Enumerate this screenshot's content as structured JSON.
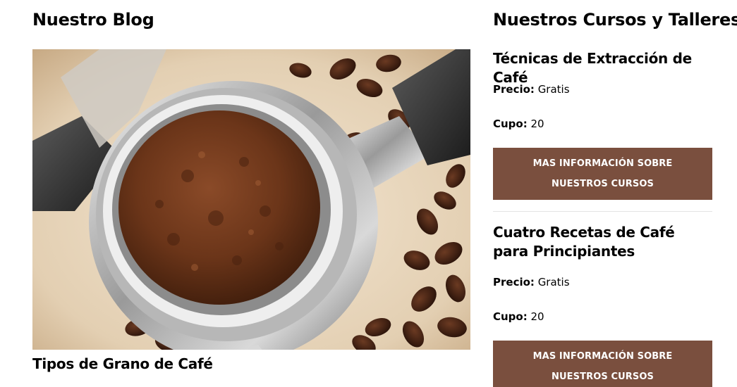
{
  "blog": {
    "heading": "Nuestro Blog",
    "post_title": "Tipos de Grano de Café",
    "image_icon": "coffee-portafilter-photo"
  },
  "courses": {
    "heading": "Nuestros Cursos y Talleres",
    "items": [
      {
        "title": "Técnicas de Extracción de Café",
        "price_label": "Precio:",
        "price_value": "Gratis",
        "quota_label": "Cupo:",
        "quota_value": "20",
        "button_label": "MAS INFORMACIÓN SOBRE NUESTROS CURSOS"
      },
      {
        "title": "Cuatro Recetas de Café para Principiantes",
        "price_label": "Precio:",
        "price_value": "Gratis",
        "quota_label": "Cupo:",
        "quota_value": "20",
        "button_label": "MAS INFORMACIÓN SOBRE NUESTROS CURSOS"
      }
    ]
  },
  "colors": {
    "button_bg": "#7a4f3e",
    "button_text": "#ffffff",
    "divider": "#e4e4e4"
  }
}
